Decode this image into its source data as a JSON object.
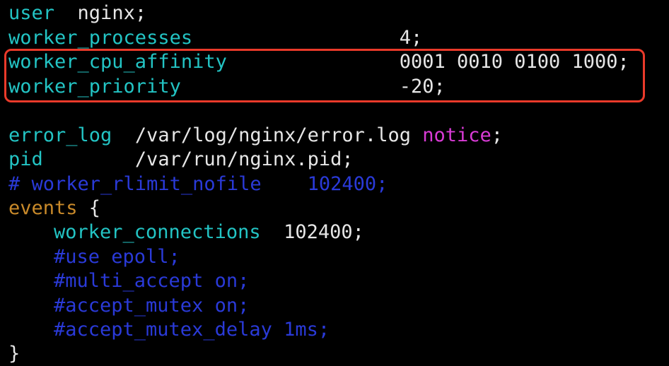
{
  "lines": {
    "l1": {
      "key": "user",
      "sep": "  ",
      "val": "nginx;"
    },
    "l2": {
      "key": "worker_processes",
      "sep": "                  ",
      "val": "4;"
    },
    "l3": {
      "key": "worker_cpu_affinity",
      "sep": "               ",
      "val": "0001 0010 0100 1000;"
    },
    "l4": {
      "key": "worker_priority",
      "sep": "                   ",
      "val": "-20;"
    },
    "l6": {
      "key": "error_log",
      "sep": "  ",
      "val": "/var/log/nginx/error.log ",
      "level": "notice",
      "end": ";"
    },
    "l7": {
      "key": "pid",
      "sep": "        ",
      "val": "/var/run/nginx.pid;"
    },
    "l8": {
      "comment": "# worker_rlimit_nofile    102400;"
    },
    "l9": {
      "key": "events",
      "brace": " {"
    },
    "l10": {
      "key": "worker_connections",
      "sep": "  ",
      "val": "102400;"
    },
    "l11": {
      "comment": "#use epoll;"
    },
    "l12": {
      "comment": "#multi_accept on;"
    },
    "l13": {
      "comment": "#accept_mutex on;"
    },
    "l14": {
      "comment": "#accept_mutex_delay 1ms;"
    },
    "l15": {
      "brace": "}"
    }
  },
  "colors": {
    "background": "#000000",
    "directive": "#23c4c4",
    "value": "#e6e6e6",
    "comment": "#2a3ad8",
    "log_level": "#d93bd6",
    "block_keyword": "#c98a2a",
    "highlight_border": "#ea3a2a"
  }
}
